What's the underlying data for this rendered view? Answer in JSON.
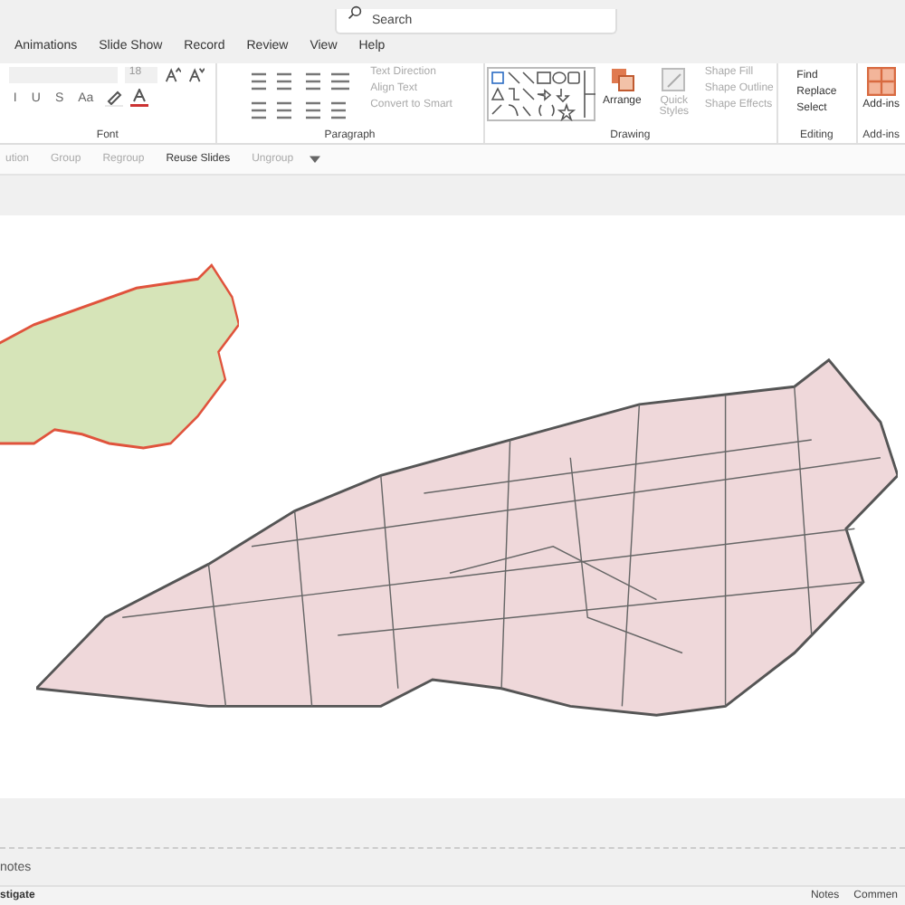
{
  "search": {
    "placeholder": "Search"
  },
  "tabs": [
    {
      "label": "Animations",
      "selected": false
    },
    {
      "label": "Slide Show",
      "selected": false
    },
    {
      "label": "Record",
      "selected": false
    },
    {
      "label": "Review",
      "selected": false
    },
    {
      "label": "View",
      "selected": false
    },
    {
      "label": "Help",
      "selected": false
    }
  ],
  "ribbon": {
    "font": {
      "label": "Font",
      "size": "18",
      "buttons": [
        "I",
        "U",
        "S",
        "Aa"
      ]
    },
    "paragraph": {
      "label": "Paragraph",
      "items": [
        {
          "label": "Text Direction",
          "disabled": true
        },
        {
          "label": "Align Text",
          "disabled": true
        },
        {
          "label": "Convert to Smart",
          "disabled": true
        }
      ]
    },
    "drawing": {
      "label": "Drawing",
      "arrange": "Arrange",
      "quick_styles": {
        "label": "Quick Styles",
        "disabled": true
      },
      "items": [
        {
          "label": "Shape Fill",
          "disabled": true
        },
        {
          "label": "Shape Outline",
          "disabled": true
        },
        {
          "label": "Shape Effects",
          "disabled": true
        }
      ]
    },
    "editing": {
      "label": "Editing",
      "items": [
        {
          "label": "Find",
          "disabled": false
        },
        {
          "label": "Replace",
          "disabled": false
        },
        {
          "label": "Select",
          "disabled": false
        }
      ]
    },
    "addins": {
      "label": "Add-ins",
      "button": "Add-ins"
    }
  },
  "toolbar": [
    {
      "label": "ution",
      "disabled": true
    },
    {
      "label": "Group",
      "disabled": true
    },
    {
      "label": "Regroup",
      "disabled": true
    },
    {
      "label": "Reuse Slides",
      "disabled": false
    },
    {
      "label": "Ungroup",
      "disabled": true
    }
  ],
  "notes": {
    "placeholder": "notes"
  },
  "status_bar": {
    "left": "stigate",
    "buttons": [
      "Notes",
      "Commen"
    ]
  }
}
